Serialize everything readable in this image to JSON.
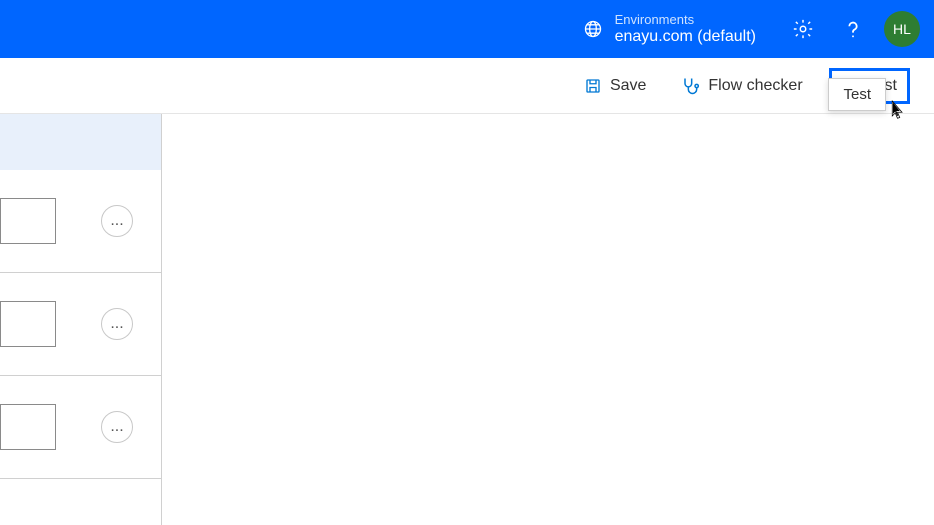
{
  "header": {
    "env_label": "Environments",
    "env_value": "enayu.com (default)",
    "avatar_initials": "HL"
  },
  "toolbar": {
    "save_label": "Save",
    "flow_checker_label": "Flow checker",
    "test_label": "Test"
  },
  "tooltip": {
    "text": "Test"
  },
  "side_panel": {
    "rows": [
      {
        "more": "..."
      },
      {
        "more": "..."
      },
      {
        "more": "..."
      }
    ]
  }
}
